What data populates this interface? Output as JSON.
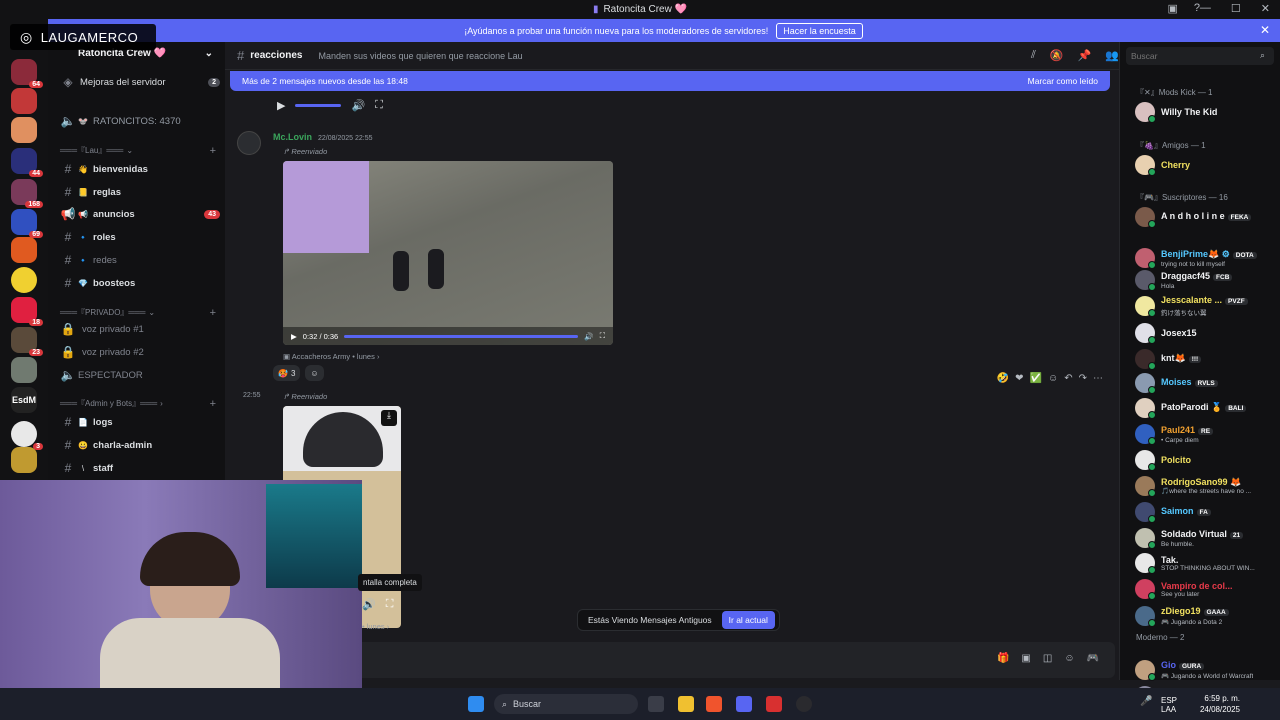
{
  "window": {
    "title": "Ratoncita Crew 🩷"
  },
  "banner": {
    "text": "¡Ayúdanos a probar una función nueva para los moderadores de servidores!",
    "button": "Hacer la encuesta"
  },
  "overlay": {
    "text": "LAUGAMERCO"
  },
  "server": {
    "name": "Ratoncita Crew 🩷"
  },
  "guild_badges": [
    "64",
    "44",
    "168",
    "69",
    "18",
    "23",
    "3"
  ],
  "channels": {
    "boost": {
      "label": "Mejoras del servidor",
      "count": "2"
    },
    "voice_count": "RATONCITOS: 4370",
    "cat_lau": "═══『Lau』═══",
    "cat_privado": "═══『PRIVADO』═══",
    "cat_admin": "═══『Admin y Bots』═══",
    "items": [
      {
        "label": "bienvenidas",
        "emoji": "👋"
      },
      {
        "label": "reglas",
        "emoji": "📒"
      },
      {
        "label": "anuncios",
        "emoji": "📢",
        "count": "43"
      },
      {
        "label": "roles",
        "emoji": "🔹"
      },
      {
        "label": "redes",
        "emoji": "🔹"
      },
      {
        "label": "boosteos",
        "emoji": "💎"
      }
    ],
    "voice": [
      {
        "label": "voz privado #1"
      },
      {
        "label": "voz privado #2"
      },
      {
        "label": "ESPECTADOR"
      }
    ],
    "admin": [
      {
        "label": "logs",
        "emoji": "📄"
      },
      {
        "label": "charla-admin",
        "emoji": "😀"
      },
      {
        "label": "staff",
        "emoji": "\\"
      }
    ]
  },
  "chat": {
    "channel": "reacciones",
    "topic": "Manden sus videos que quieren que reaccione Lau",
    "newmsg": "Más de 2 mensajes nuevos desde las 18:48",
    "mark_read": "Marcar como leído",
    "author": "Mc.Lovin",
    "timestamp": "22/08/2025 22:55",
    "forwarded": "Reenviado",
    "video_time": "0:32 / 0:36",
    "source": "Accacheros Army",
    "source_day": "lunes",
    "reaction_count": "3",
    "msg2_time": "22:55",
    "source2_day": "lunes",
    "tooltip": "ntalla completa",
    "viewing": "Estás Viendo Mensajes Antiguos",
    "goto": "Ir al actual"
  },
  "members": {
    "search_placeholder": "Buscar",
    "sections": [
      {
        "title": "『✕』Mods Kick — 1"
      },
      {
        "title": "『🍇』Amigos — 1"
      },
      {
        "title": "『🎮』Suscriptores — 16"
      },
      {
        "title": "Moderno — 2"
      }
    ],
    "list": [
      {
        "name": "Willy The Kid",
        "color": "#f2f3f5"
      },
      {
        "name": "Cherry",
        "color": "#f0e060"
      },
      {
        "name": "A n d h o l i n e",
        "color": "#f2f3f5",
        "tag": "FEKA"
      },
      {
        "name": "BenjiPrime🦊 ⚙",
        "color": "#55c8ff",
        "tag": "DOTA",
        "status": "trying not to kill myself"
      },
      {
        "name": "Draggacf45",
        "color": "#f2f3f5",
        "tag": "FCB",
        "status": "Hola"
      },
      {
        "name": "Jesscalante ...",
        "color": "#f0e060",
        "tag": "PVZF",
        "status": "釣け落ちない翼"
      },
      {
        "name": "Josex15",
        "color": "#f2f3f5"
      },
      {
        "name": "knt🦊",
        "color": "#f2f3f5",
        "tag": "!!!"
      },
      {
        "name": "Moises",
        "color": "#55c8ff",
        "tag": "RVLS"
      },
      {
        "name": "PatoParodi 🏅",
        "color": "#f2f3f5",
        "tag": "BALI"
      },
      {
        "name": "Paul241",
        "color": "#f0a030",
        "tag": "RE",
        "status": "• Carpe diem"
      },
      {
        "name": "Polcito",
        "color": "#f0e060"
      },
      {
        "name": "RodrigoSano99 🦊",
        "color": "#f0e060",
        "status": "🎵where the streets have no ..."
      },
      {
        "name": "Saimon",
        "color": "#55c8ff",
        "tag": "FA"
      },
      {
        "name": "Soldado Virtual",
        "color": "#f2f3f5",
        "tag": "21",
        "status": "Be humble."
      },
      {
        "name": "Tak.",
        "color": "#f2f3f5",
        "status": "STOP THINKING ABOUT WIN..."
      },
      {
        "name": "Vampiro de col...",
        "color": "#e83a4a",
        "status": "See you later"
      },
      {
        "name": "zDiego19",
        "color": "#f0e060",
        "tag": "GAAA",
        "status": "🎮 Jugando a Dota 2"
      },
      {
        "name": "Gio",
        "color": "#5865f2",
        "tag": "GURA",
        "status": "🎮 Jugando a World of Warcraft"
      },
      {
        "name": "rexbeto",
        "color": "#f2f3f5"
      }
    ]
  },
  "taskbar": {
    "search": "Buscar",
    "lang": "ESP",
    "lang2": "LAA",
    "time": "6:59 p. m.",
    "date": "24/08/2025"
  }
}
